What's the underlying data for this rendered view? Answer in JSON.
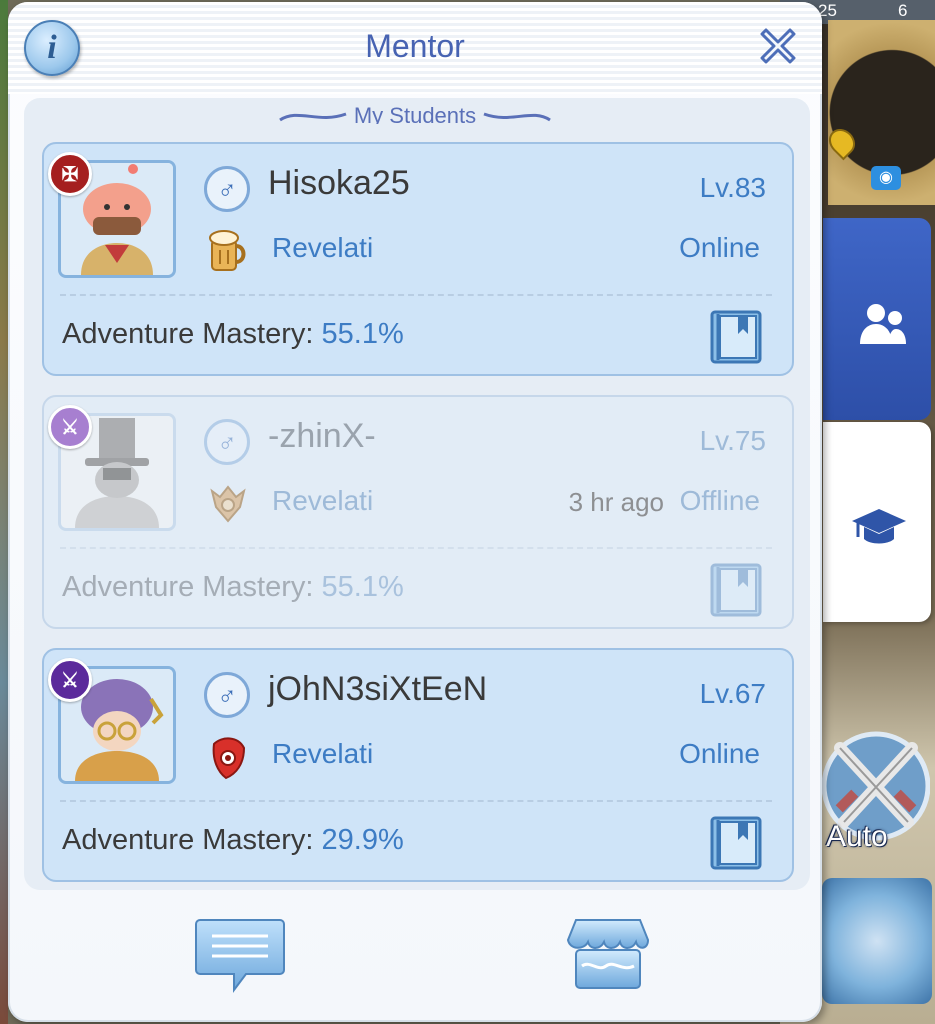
{
  "status_bar": {
    "left_text": "25",
    "right_text": "6"
  },
  "game_hud": {
    "auto_label": "Auto"
  },
  "window": {
    "title": "Mentor",
    "section_title": "My Students",
    "info_glyph": "i"
  },
  "students": [
    {
      "name": "Hisoka25",
      "level": "Lv.83",
      "guild": "Revelati",
      "status": "Online",
      "last_seen": "",
      "mastery_label": "Adventure Mastery:",
      "mastery_value": "55.1%",
      "badge_color": "#a51f1f",
      "gender_glyph": "♂",
      "online": true
    },
    {
      "name": "-zhinX-",
      "level": "Lv.75",
      "guild": "Revelati",
      "status": "Offline",
      "last_seen": "3 hr ago",
      "mastery_label": "Adventure Mastery:",
      "mastery_value": "55.1%",
      "badge_color": "#a77fd0",
      "gender_glyph": "♂",
      "online": false
    },
    {
      "name": "jOhN3siXtEeN",
      "level": "Lv.67",
      "guild": "Revelati",
      "status": "Online",
      "last_seen": "",
      "mastery_label": "Adventure Mastery:",
      "mastery_value": "29.9%",
      "badge_color": "#5b2a9b",
      "gender_glyph": "♂",
      "online": true
    }
  ],
  "colors": {
    "accent": "#3d7cc4",
    "title": "#4763b2",
    "card_bg": "#cfe4f8"
  },
  "icons": {
    "info": "info-icon",
    "close": "close-icon",
    "gender": "male-icon",
    "guild": "guild-emblem-icon",
    "book": "mastery-book-icon",
    "chat": "chat-icon",
    "shop": "shop-icon",
    "friends_tab": "people-icon",
    "mentor_tab": "graduation-cap-icon"
  }
}
